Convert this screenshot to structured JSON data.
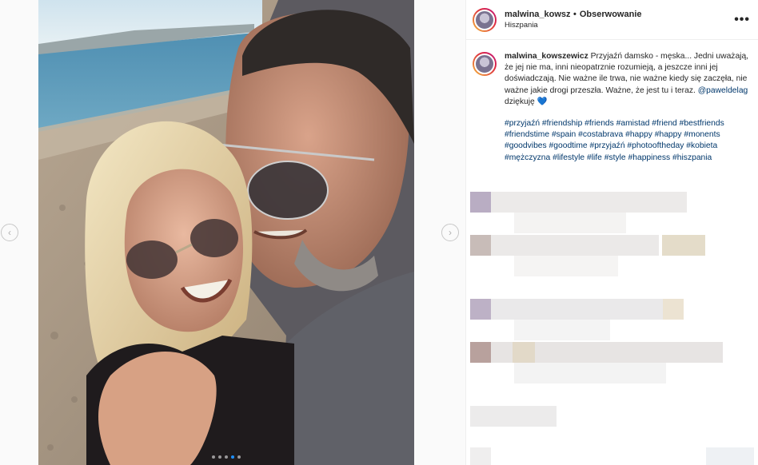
{
  "post": {
    "username": "malwina_kowszewicz",
    "username_truncated": "malwina_kowszev",
    "separator": "•",
    "follow_label": "Obserwowanie",
    "location": "Hiszpania",
    "more_label": "•••",
    "caption_text": "Przyjaźń damsko - męska... Jedni uważają, że jej nie ma, inni nieopatrznie rozumieją, a jeszcze inni jej doświadczają. Nie ważne ile trwa, nie ważne kiedy się zaczęła, nie ważne jakie drogi przeszła. Ważne, że jest tu i teraz.",
    "mention": "@paweldelag",
    "thanks": "dziękuję",
    "heart": "💙",
    "hashtags": "#przyjaźń #friendship #friends #amistad #friend #bestfriends #friendstime #spain #costabrava #happy #happy #monents #goodvibes #goodtime #przyjaźń #photooftheday #kobieta #mężczyzna #lifestyle #life #style #happiness #hiszpania"
  },
  "carousel": {
    "prev_icon": "‹",
    "next_icon": "›",
    "dot_count": 5,
    "active_dot": 3
  },
  "colors": {
    "accent_link": "#00376b",
    "carousel_active": "#1e90ff"
  }
}
